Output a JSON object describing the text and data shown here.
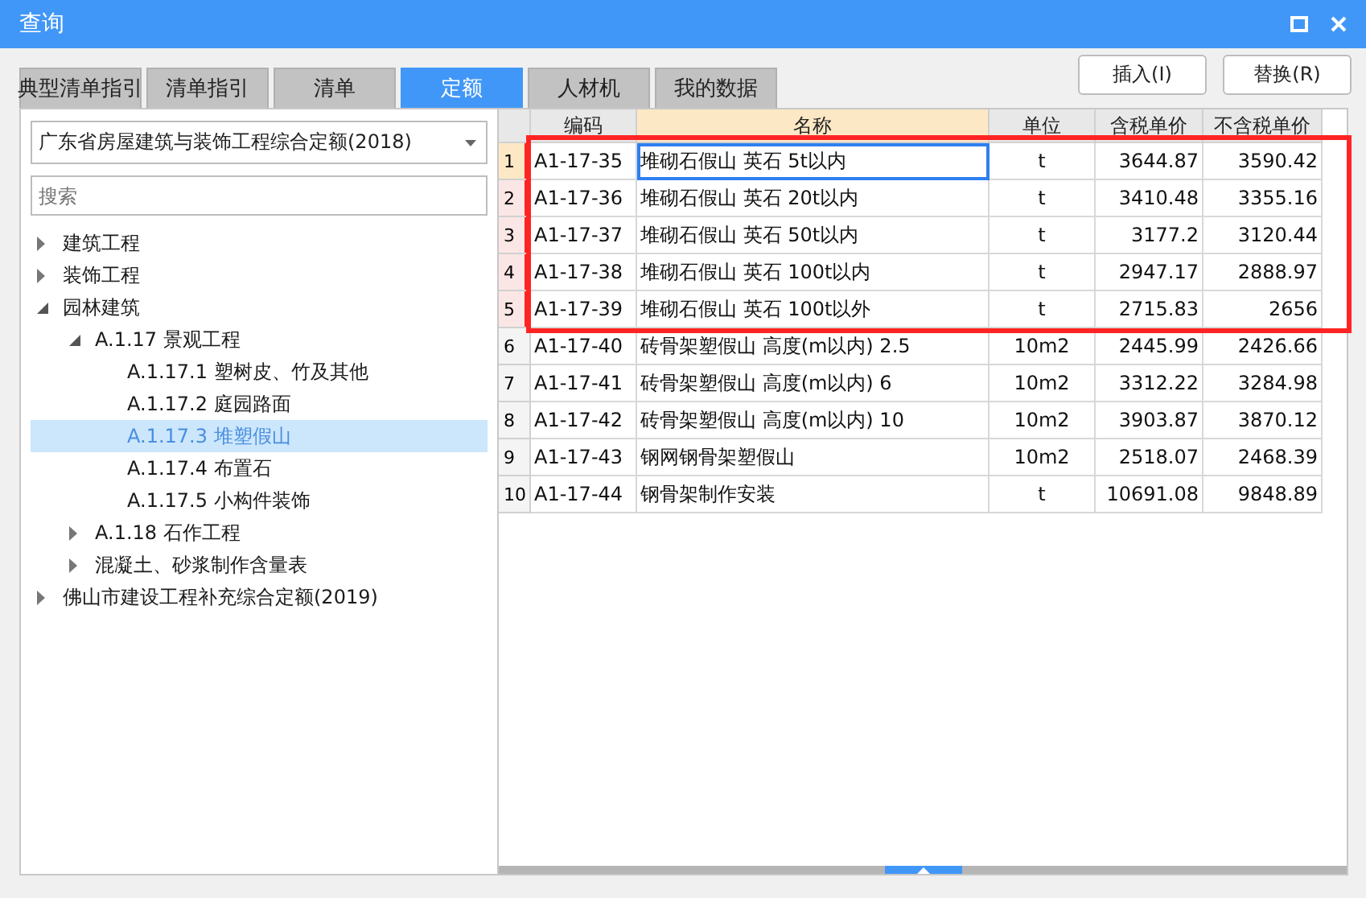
{
  "window": {
    "title": "查询"
  },
  "tabs": [
    {
      "label": "典型清单指引",
      "selected": false
    },
    {
      "label": "清单指引",
      "selected": false
    },
    {
      "label": "清单",
      "selected": false
    },
    {
      "label": "定额",
      "selected": true
    },
    {
      "label": "人材机",
      "selected": false
    },
    {
      "label": "我的数据",
      "selected": false
    }
  ],
  "buttons": [
    "插入(I)",
    "替换(R)"
  ],
  "sidebar": {
    "dropdown": "广东省房屋建筑与装饰工程综合定额(2018)",
    "search": {
      "placeholder": "搜索"
    },
    "tree": [
      {
        "label": "建筑工程",
        "expanded": false,
        "selected": false
      },
      {
        "label": "装饰工程",
        "expanded": false,
        "selected": false
      },
      {
        "label": "园林建筑",
        "expanded": true,
        "selected": false,
        "children": [
          {
            "label": "A.1.17 景观工程",
            "expanded": true,
            "selected": false,
            "children": [
              {
                "label": "A.1.17.1 塑树皮、竹及其他",
                "selected": false
              },
              {
                "label": "A.1.17.2 庭园路面",
                "selected": false
              },
              {
                "label": "A.1.17.3 堆塑假山",
                "selected": true
              },
              {
                "label": "A.1.17.4 布置石",
                "selected": false
              },
              {
                "label": "A.1.17.5 小构件装饰",
                "selected": false
              }
            ]
          },
          {
            "label": "A.1.18 石作工程",
            "expanded": false,
            "selected": false
          },
          {
            "label": "混凝土、砂浆制作含量表",
            "expanded": false,
            "selected": false
          }
        ]
      },
      {
        "label": "佛山市建设工程补充综合定额(2019)",
        "expanded": false,
        "selected": false
      }
    ]
  },
  "table": {
    "columns": [
      {
        "label": "编码",
        "active": false
      },
      {
        "label": "名称",
        "active": true
      },
      {
        "label": "单位",
        "active": false
      },
      {
        "label": "含税单价",
        "active": false
      },
      {
        "label": "不含税单价",
        "active": false
      }
    ],
    "rows": [
      {
        "num": "1",
        "selected": true,
        "highlighted": true,
        "cells": [
          "A1-17-35",
          "堆砌石假山 英石 5t以内",
          "t",
          "3644.87",
          "3590.42"
        ]
      },
      {
        "num": "2",
        "selected": false,
        "highlighted": true,
        "cells": [
          "A1-17-36",
          "堆砌石假山 英石 20t以内",
          "t",
          "3410.48",
          "3355.16"
        ]
      },
      {
        "num": "3",
        "selected": false,
        "highlighted": true,
        "cells": [
          "A1-17-37",
          "堆砌石假山 英石 50t以内",
          "t",
          "3177.2",
          "3120.44"
        ]
      },
      {
        "num": "4",
        "selected": false,
        "highlighted": true,
        "cells": [
          "A1-17-38",
          "堆砌石假山 英石 100t以内",
          "t",
          "2947.17",
          "2888.97"
        ]
      },
      {
        "num": "5",
        "selected": false,
        "highlighted": true,
        "cells": [
          "A1-17-39",
          "堆砌石假山 英石 100t以外",
          "t",
          "2715.83",
          "2656"
        ]
      },
      {
        "num": "6",
        "selected": false,
        "highlighted": false,
        "cells": [
          "A1-17-40",
          "砖骨架塑假山 高度(m以内) 2.5",
          "10m2",
          "2445.99",
          "2426.66"
        ]
      },
      {
        "num": "7",
        "selected": false,
        "highlighted": false,
        "cells": [
          "A1-17-41",
          "砖骨架塑假山 高度(m以内) 6",
          "10m2",
          "3312.22",
          "3284.98"
        ]
      },
      {
        "num": "8",
        "selected": false,
        "highlighted": false,
        "cells": [
          "A1-17-42",
          "砖骨架塑假山 高度(m以内) 10",
          "10m2",
          "3903.87",
          "3870.12"
        ]
      },
      {
        "num": "9",
        "selected": false,
        "highlighted": false,
        "cells": [
          "A1-17-43",
          "钢网钢骨架塑假山",
          "10m2",
          "2518.07",
          "2468.39"
        ]
      },
      {
        "num": "10",
        "selected": false,
        "highlighted": false,
        "cells": [
          "A1-17-44",
          "钢骨架制作安装",
          "t",
          "10691.08",
          "9848.89"
        ]
      }
    ]
  }
}
